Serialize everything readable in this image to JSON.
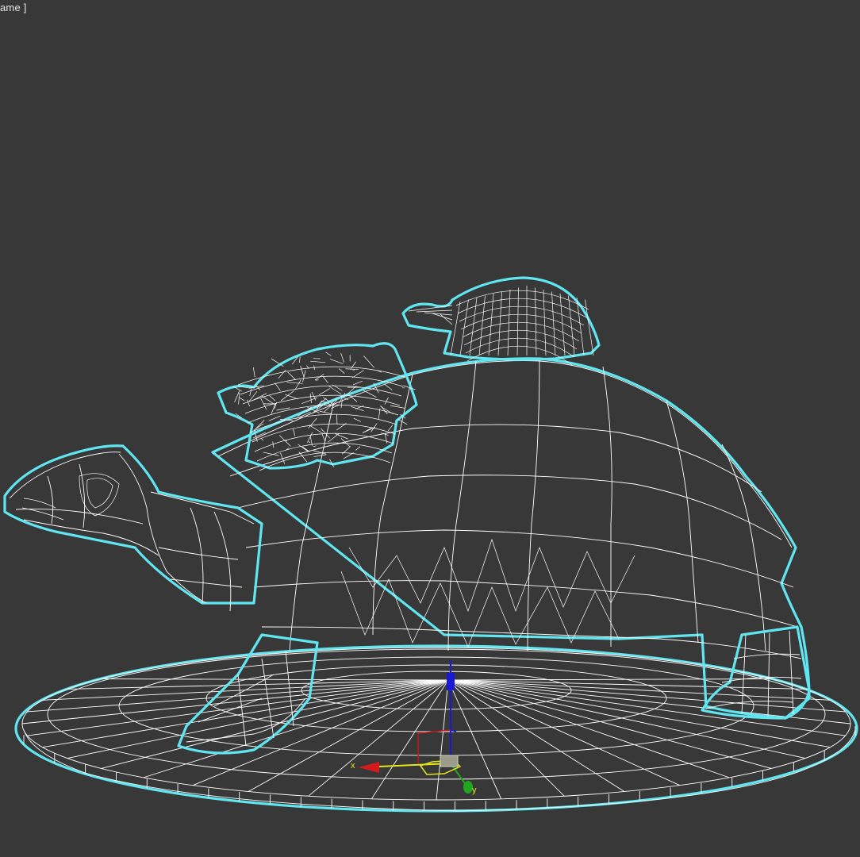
{
  "viewport": {
    "label": "ame ]",
    "background_color": "#383838",
    "wire_color": "#ffffff",
    "selection_color": "#5fe6f0"
  },
  "gizmo": {
    "x_label": "x",
    "y_label": "y",
    "x_color": "#d41a1a",
    "y_color": "#1fa81f",
    "z_color": "#1a1ad4",
    "plane_color": "#e5e51a"
  }
}
